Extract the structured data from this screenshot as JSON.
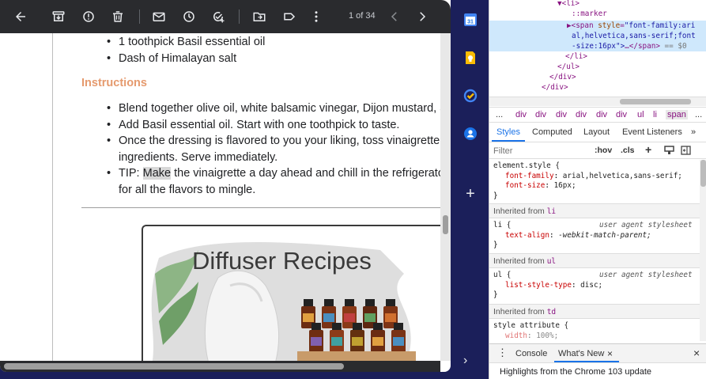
{
  "gmail": {
    "toolbar": {
      "counter": "1 of 34",
      "icons": [
        "back-arrow-icon",
        "archive-icon",
        "report-spam-icon",
        "delete-icon",
        "mark-unread-icon",
        "snooze-icon",
        "add-to-tasks-icon",
        "move-to-icon",
        "label-icon",
        "more-icon",
        "newer-icon",
        "older-icon"
      ]
    },
    "email": {
      "ingredients_tail": [
        "1 toothpick Basil essential oil",
        "Dash of Himalayan salt"
      ],
      "instructions_heading": "Instructions",
      "steps": [
        {
          "lines": [
            "Blend together olive oil, white balsamic vinegar, Dijon mustard, and"
          ]
        },
        {
          "lines": [
            "Add Basil essential oil. Start with one toothpick to taste."
          ]
        },
        {
          "lines": [
            "Once the dressing is flavored to you your liking, toss vinaigrette with",
            "ingredients. Serve immediately."
          ]
        },
        {
          "tip_prefix": "TIP: ",
          "tip_highlight": "Make",
          "tip_rest": " the vinaigrette a day ahead and chill in the refrigerator to",
          "tip_line2": "for all the flavors to mingle."
        }
      ],
      "recipe_image_title": "Diffuser Recipes",
      "oil_colors": [
        "#6b2c12",
        "#7a3315",
        "#8a3a18",
        "#5e2710",
        "#7d3415",
        "#6f2e12",
        "#8c3c19",
        "#643010"
      ],
      "label_colors": [
        "#e0a040",
        "#4a8fc0",
        "#c04040",
        "#60a060",
        "#d07030",
        "#8060b0",
        "#40a0a0",
        "#c0a030"
      ]
    }
  },
  "rail": {
    "icons": [
      "calendar-app-icon",
      "keep-app-icon",
      "tasks-app-icon",
      "contacts-app-icon",
      "get-addons-icon",
      "expand-panel-icon"
    ],
    "calendar_day": "31",
    "add_symbol": "+",
    "expand_symbol": "›"
  },
  "devtools": {
    "dom": {
      "li_open": "▼<li>",
      "marker": "::marker",
      "span_line1_tag": "▶<span ",
      "span_attr": "style",
      "span_line1_val": "\"font-family:ari",
      "span_line2": "al,helvetica,sans-serif;font",
      "span_line3_val": "-size:16px\">",
      "span_line3_close": "…</span>",
      "span_line3_eq": " == $0",
      "li_close": "</li>",
      "ul_close": "</ul>",
      "div_close1": "</div>",
      "div_close2": "</div>"
    },
    "breadcrumbs": [
      "...",
      "div",
      "div",
      "div",
      "div",
      "div",
      "div",
      "ul",
      "li",
      "span",
      "..."
    ],
    "tabs": [
      "Styles",
      "Computed",
      "Layout",
      "Event Listeners",
      "»"
    ],
    "filter": {
      "placeholder": "Filter",
      "hov": ":hov",
      "cls": ".cls",
      "plus": "+"
    },
    "styles": {
      "element_style": "element.style {",
      "ff_prop": "font-family",
      "ff_val": "arial,helvetica,sans-serif;",
      "fs_prop": "font-size",
      "fs_val": "16px;",
      "close": "}",
      "inherited_label": "Inherited from",
      "li_tag": "li",
      "ul_tag": "ul",
      "td_tag": "td",
      "li_rule": "li {",
      "ua_label": "user agent stylesheet",
      "ta_prop": "text-align",
      "ta_val": "-webkit-match-parent;",
      "ul_rule": "ul {",
      "lst_prop": "list-style-type",
      "lst_val": "disc;",
      "style_attr": "style attribute {",
      "w_prop": "width",
      "w_val": "100%;"
    },
    "drawer": {
      "menu": "⋮",
      "console": "Console",
      "whats_new": "What's New",
      "tab_close": "×",
      "drawer_close": "×"
    },
    "highlights": "Highlights from the Chrome 103 update"
  }
}
